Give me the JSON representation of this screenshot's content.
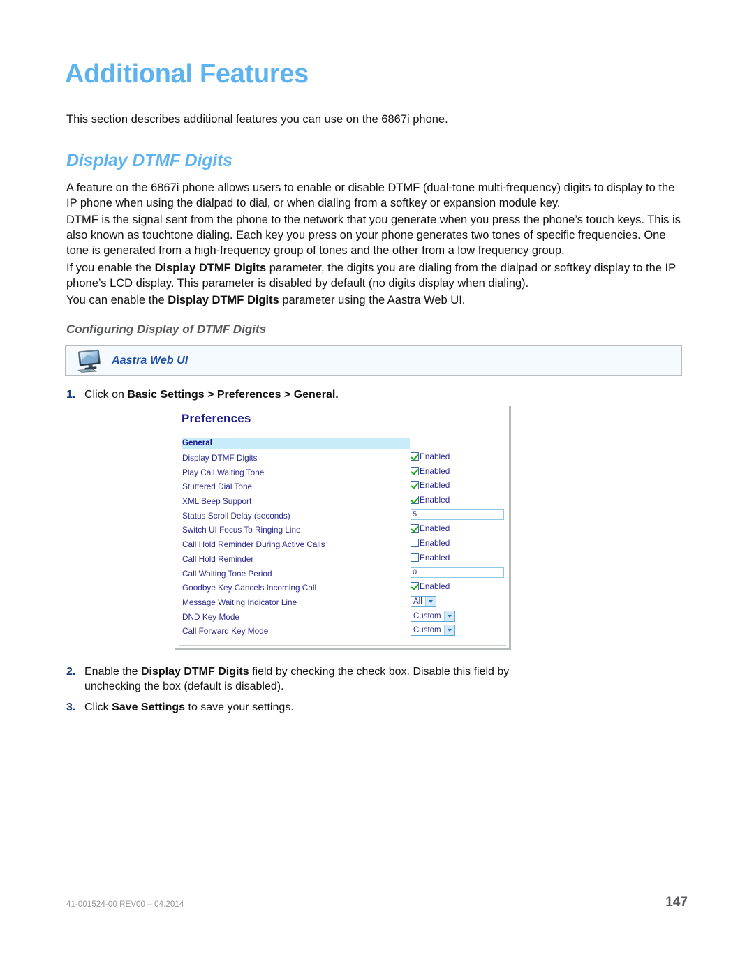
{
  "page_title": "Additional Features",
  "intro": "This section describes additional features you can use on the 6867i phone.",
  "section_heading": "Display DTMF Digits",
  "paragraphs": {
    "p1": "A feature on the 6867i phone allows users to enable or disable DTMF (dual-tone multi-frequency) digits to display to the IP phone when using the dialpad to dial, or when dialing from a softkey or expansion module key.",
    "p2": "DTMF is the signal sent from the phone to the network that you generate when you press the phone’s touch keys. This is also known as touchtone dialing. Each key you press on your phone generates two tones of specific frequencies. One tone is generated from a high-frequency group of tones and the other from a low frequency group.",
    "p3_a": "If you enable the ",
    "p3_b": "Display DTMF Digits",
    "p3_c": " parameter, the digits you are dialing from the dialpad or softkey display to the IP phone’s LCD display. This parameter is disabled by default (no digits display when dialing).",
    "p4_a": "You can enable the ",
    "p4_b": "Display DTMF Digits",
    "p4_c": " parameter using the Aastra Web UI."
  },
  "subheading": "Configuring Display of DTMF Digits",
  "ui_banner": {
    "label": "Aastra Web UI",
    "icon": "computer-monitor-icon"
  },
  "steps": {
    "step1": {
      "num": "1.",
      "a": "Click on ",
      "b": "Basic Settings > Preferences > General.",
      "c": ""
    },
    "step2": {
      "num": "2.",
      "a": "Enable the ",
      "b": "Display DTMF Digits",
      "c": " field by checking the check box. Disable this field by unchecking the box (default is disabled)."
    },
    "step3": {
      "num": "3.",
      "a": "Click ",
      "b": "Save Settings",
      "c": " to save your settings."
    }
  },
  "screenshot": {
    "title": "Preferences",
    "group_header": "General",
    "enabled_label": "Enabled",
    "rows": [
      {
        "label": "Display DTMF Digits",
        "type": "checkbox",
        "checked": true,
        "value": "Enabled"
      },
      {
        "label": "Play Call Waiting Tone",
        "type": "checkbox",
        "checked": true,
        "value": "Enabled"
      },
      {
        "label": "Stuttered Dial Tone",
        "type": "checkbox",
        "checked": true,
        "value": "Enabled"
      },
      {
        "label": "XML Beep Support",
        "type": "checkbox",
        "checked": true,
        "value": "Enabled"
      },
      {
        "label": "Status Scroll Delay (seconds)",
        "type": "text",
        "value": "5"
      },
      {
        "label": "Switch UI Focus To Ringing Line",
        "type": "checkbox",
        "checked": true,
        "value": "Enabled"
      },
      {
        "label": "Call Hold Reminder During Active Calls",
        "type": "checkbox",
        "checked": false,
        "value": "Enabled"
      },
      {
        "label": "Call Hold Reminder",
        "type": "checkbox",
        "checked": false,
        "value": "Enabled"
      },
      {
        "label": "Call Waiting Tone Period",
        "type": "text",
        "value": "0"
      },
      {
        "label": "Goodbye Key Cancels Incoming Call",
        "type": "checkbox",
        "checked": true,
        "value": "Enabled"
      },
      {
        "label": "Message Waiting Indicator Line",
        "type": "select",
        "value": "All"
      },
      {
        "label": "DND Key Mode",
        "type": "select",
        "value": "Custom"
      },
      {
        "label": "Call Forward Key Mode",
        "type": "select",
        "value": "Custom"
      }
    ]
  },
  "footer": {
    "left": "41-001524-00 REV00 – 04.2014",
    "page_number": "147"
  },
  "colors": {
    "title_blue": "#5cb3ef",
    "heading_blue": "#5cb3ef",
    "step_num_blue": "#1a3f78",
    "ui_label_blue": "#1f4fa8",
    "shot_title_navy": "#1a1a8c",
    "group_bar_cyan": "#c9ecfb",
    "check_green": "#18a818",
    "footer_gray": "#939598"
  }
}
